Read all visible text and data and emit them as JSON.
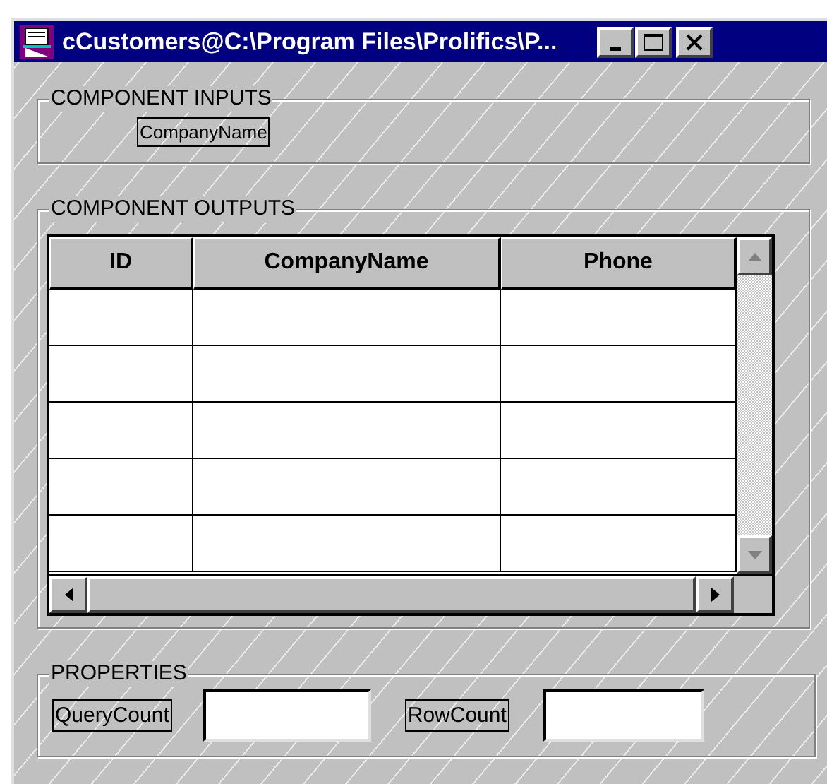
{
  "window": {
    "title": "cCustomers@C:\\Program Files\\Prolifics\\P..."
  },
  "inputs": {
    "title": "COMPONENT INPUTS",
    "fields": [
      {
        "label": "CompanyName"
      }
    ]
  },
  "outputs": {
    "title": "COMPONENT OUTPUTS",
    "table": {
      "columns": [
        "ID",
        "CompanyName",
        "Phone"
      ]
    }
  },
  "properties": {
    "title": "PROPERTIES",
    "fields": [
      {
        "label": "QueryCount"
      },
      {
        "label": "RowCount"
      }
    ]
  }
}
